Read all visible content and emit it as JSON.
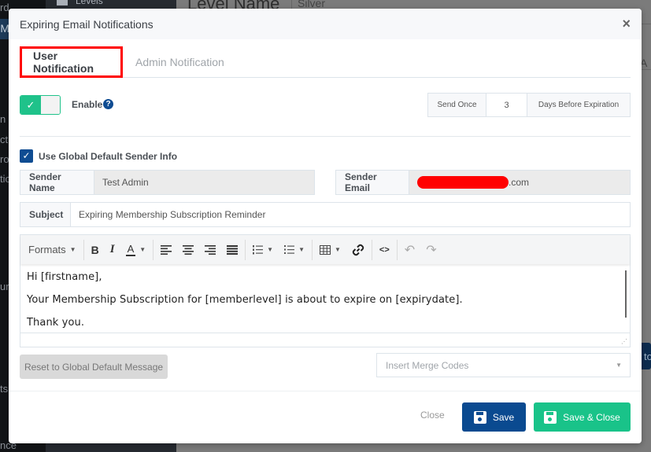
{
  "background": {
    "sidebar_items": [
      "rd",
      "M",
      "n",
      "ct",
      "rol",
      "tio",
      "ure",
      "ts",
      "nce"
    ],
    "submenu_item": "Levels",
    "level_name_label": "Level Name",
    "level_name_value": "Silver",
    "right_fragment": "A",
    "right_button_fragment": "n to"
  },
  "modal": {
    "title": "Expiring Email Notifications",
    "close_icon": "×",
    "tabs": [
      {
        "label": "User Notification",
        "active": true
      },
      {
        "label": "Admin Notification",
        "active": false
      }
    ],
    "enable": {
      "label": "Enable",
      "checked": true,
      "toggle_icon": "✓",
      "help_icon": "?"
    },
    "send": {
      "prefix": "Send Once",
      "days_value": "3",
      "suffix": "Days Before Expiration"
    },
    "use_global_sender": {
      "label": "Use Global Default Sender Info",
      "checked": true,
      "check_icon": "✓"
    },
    "sender_name": {
      "label": "Sender Name",
      "value": "Test Admin"
    },
    "sender_email": {
      "label": "Sender Email",
      "value_visible_suffix": ".com",
      "redacted": true
    },
    "subject": {
      "label": "Subject",
      "value": "Expiring Membership Subscription Reminder"
    },
    "editor": {
      "toolbar": {
        "formats_label": "Formats",
        "bold": "B",
        "italic": "I",
        "font_color": "A",
        "undo": "↶",
        "redo": "↷",
        "code": "<>"
      },
      "content": [
        "Hi [firstname],",
        "Your Membership Subscription for [memberlevel] is about to expire on [expirydate].",
        "Thank you."
      ]
    },
    "reset_button": "Reset to Global Default Message",
    "merge_codes_placeholder": "Insert Merge Codes",
    "footer": {
      "close_label": "Close",
      "save_label": "Save",
      "save_close_label": "Save & Close"
    }
  },
  "colors": {
    "primary": "#0a4a90",
    "success": "#19c389",
    "highlight_border": "#ff0000"
  }
}
